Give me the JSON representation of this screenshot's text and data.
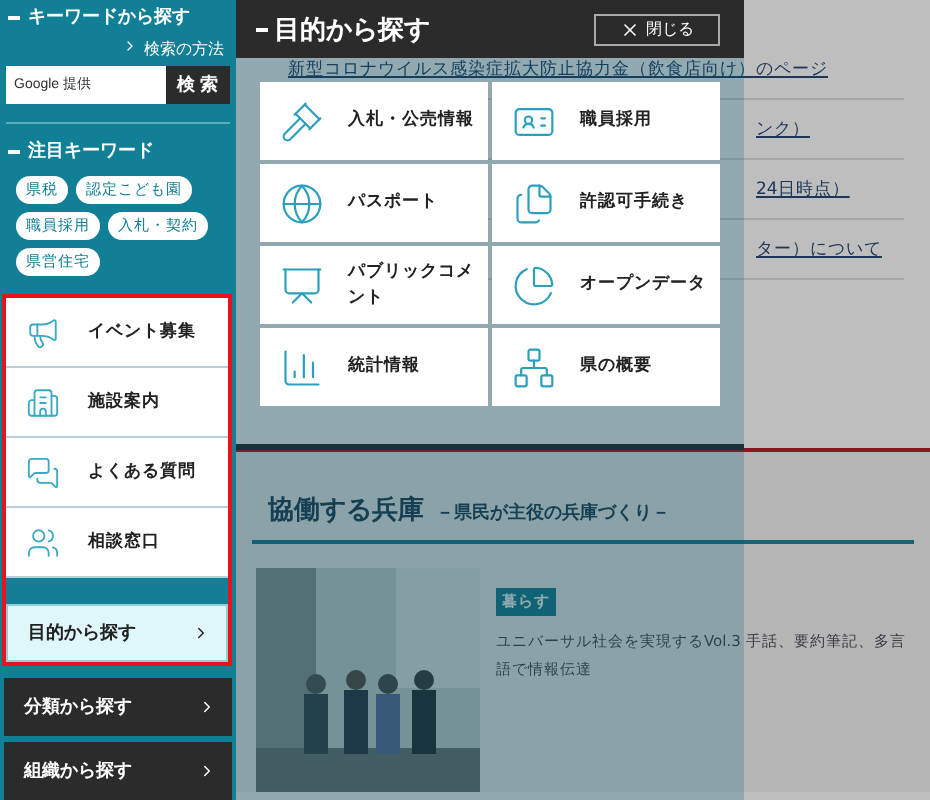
{
  "sidebar": {
    "keyword_search": {
      "title": "キーワードから探す",
      "help_link": "検索の方法",
      "placeholder": "Google 提供",
      "button": "検 索"
    },
    "featured": {
      "title": "注目キーワード",
      "tags": [
        "県税",
        "認定こども園",
        "職員採用",
        "入札・契約",
        "県営住宅"
      ]
    },
    "quick_links": [
      {
        "label": "イベント募集"
      },
      {
        "label": "施設案内"
      },
      {
        "label": "よくある質問"
      },
      {
        "label": "相談窓口"
      }
    ],
    "nav": [
      {
        "label": "目的から探す",
        "selected": true
      },
      {
        "label": "分類から探す",
        "selected": false
      },
      {
        "label": "組織から探す",
        "selected": false
      }
    ]
  },
  "page": {
    "links": [
      "新型コロナウイルス感染症拡大防止協力金（飲食店向け）のページ",
      "ンク）",
      "24日時点）",
      "ター）について"
    ],
    "section": {
      "title": "協働する兵庫",
      "subtitle": "－県民が主役の兵庫づくり－",
      "article": {
        "kind": "picture",
        "tag": "暮らす",
        "text": "ユニバーサル社会を実現するVol.3 手話、要約筆記、多言語で情報伝達"
      }
    }
  },
  "purpose_menu": {
    "title": "目的から探す",
    "close": "閉じる",
    "items": [
      {
        "label": "入札・公売情報"
      },
      {
        "label": "職員採用"
      },
      {
        "label": "パスポート"
      },
      {
        "label": "許認可手続き"
      },
      {
        "label": "パブリックコメント"
      },
      {
        "label": "オープンデータ"
      },
      {
        "label": "統計情報"
      },
      {
        "label": "県の概要"
      }
    ]
  }
}
